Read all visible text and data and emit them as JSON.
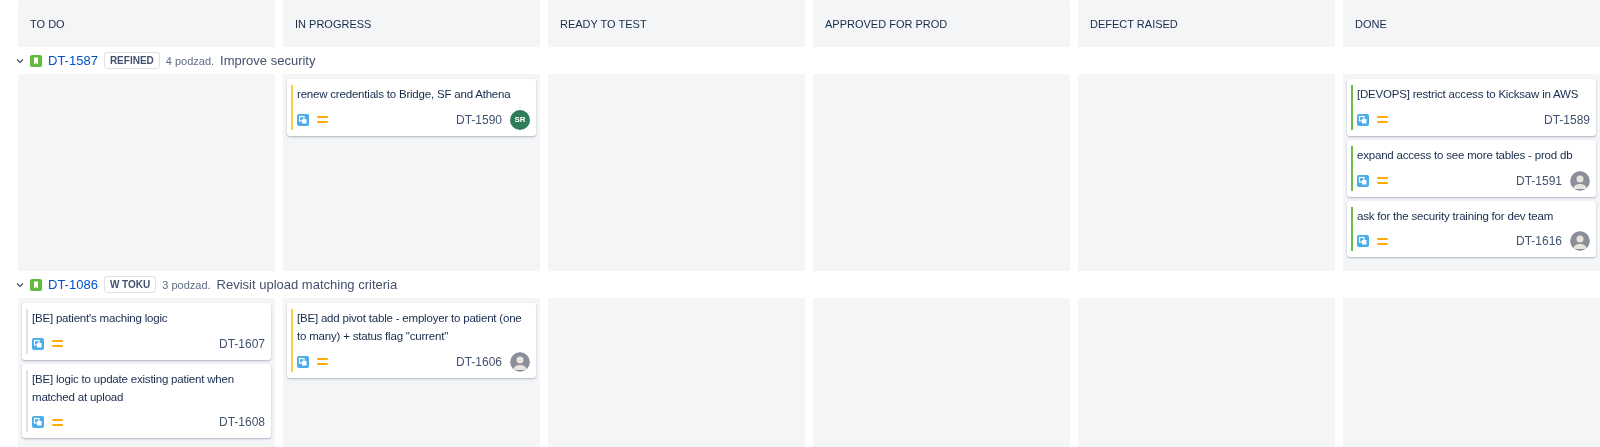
{
  "columns": [
    "TO DO",
    "IN PROGRESS",
    "READY TO TEST",
    "APPROVED FOR PROD",
    "DEFECT RAISED",
    "DONE"
  ],
  "lanes": [
    {
      "expanded": true,
      "key": "DT-1587",
      "badge": "REFINED",
      "subtasks": "4 podzad.",
      "title": "Improve security",
      "cells": [
        [],
        [
          {
            "title": "renew credentials to Bridge, SF and Athena",
            "key": "DT-1590",
            "color": "#f5cd47",
            "avatar": {
              "kind": "initials",
              "text": "SR"
            }
          }
        ],
        [],
        [],
        [],
        [
          {
            "title": "[DEVOPS] restrict access to Kicksaw in AWS",
            "key": "DT-1589",
            "color": "#6bbd45",
            "avatar": {
              "kind": "none"
            }
          },
          {
            "title": "expand access to see more tables - prod db",
            "key": "DT-1591",
            "color": "#6bbd45"
          },
          {
            "title": "ask for the security training for dev team",
            "key": "DT-1616",
            "color": "#6bbd45"
          }
        ]
      ]
    },
    {
      "expanded": true,
      "key": "DT-1086",
      "badge": "W TOKU",
      "subtasks": "3 podzad.",
      "title": "Revisit upload matching criteria",
      "cells": [
        [
          {
            "title": "[BE] patient's maching logic",
            "key": "DT-1607",
            "color": "#dfe1e6",
            "avatar": {
              "kind": "none"
            }
          },
          {
            "title": "[BE] logic to update existing patient when matched at upload",
            "key": "DT-1608",
            "color": "#dfe1e6",
            "avatar": {
              "kind": "none"
            }
          }
        ],
        [
          {
            "title": "[BE] add pivot table - employer to patient (one to many) + status flag \"current\"",
            "key": "DT-1606",
            "color": "#f5cd47"
          }
        ],
        [],
        [],
        [],
        []
      ]
    }
  ]
}
